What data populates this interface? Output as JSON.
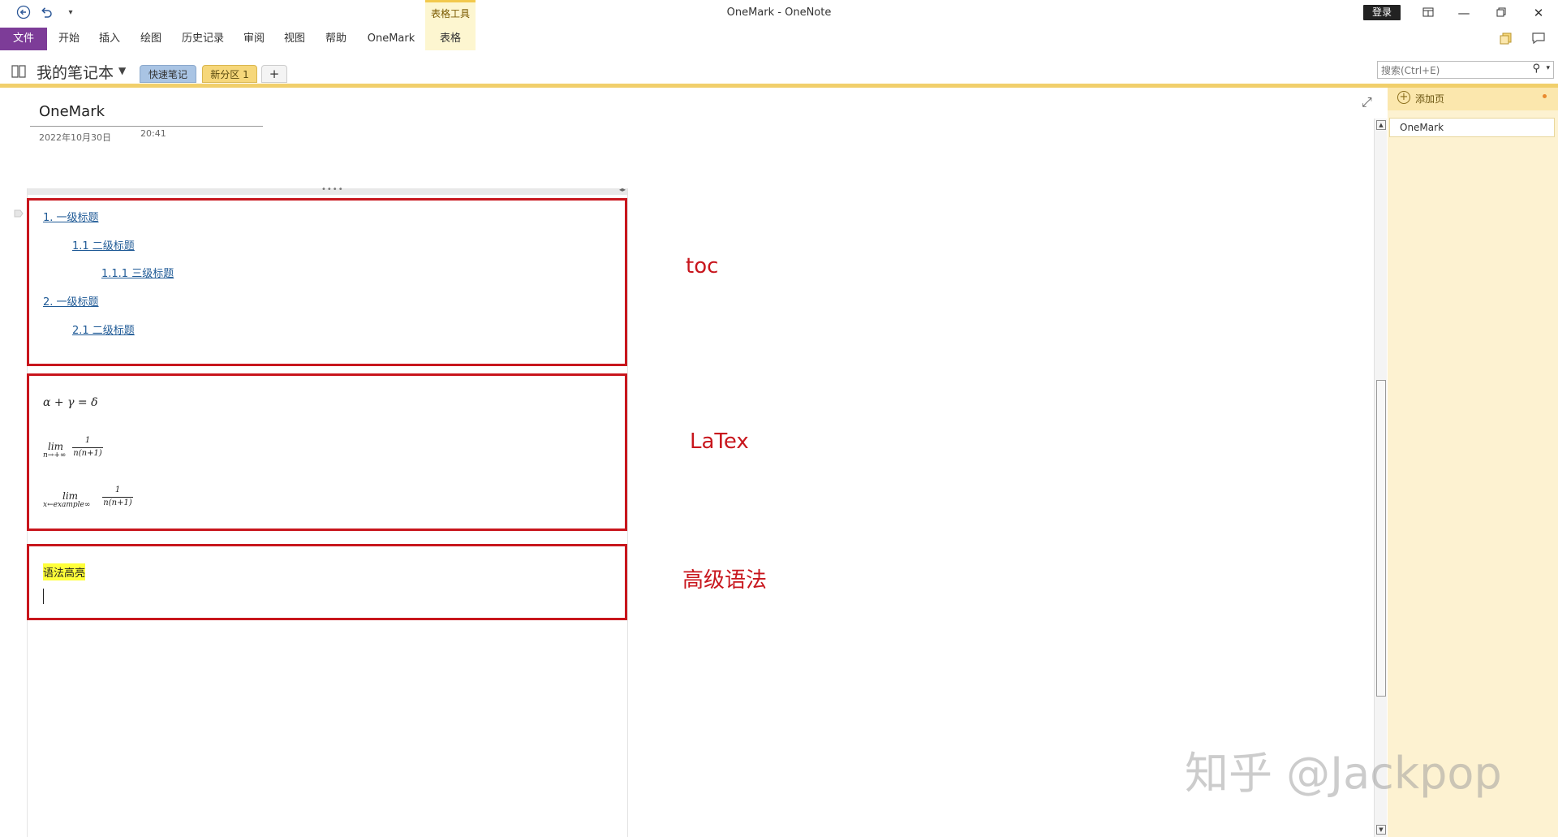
{
  "window": {
    "title": "OneMark  -  OneNote",
    "login_label": "登录",
    "ctx_group_title": "表格工具"
  },
  "ribbon": {
    "file_label": "文件",
    "tabs": [
      "开始",
      "插入",
      "绘图",
      "历史记录",
      "审阅",
      "视图",
      "帮助",
      "OneMark",
      "表格"
    ]
  },
  "notebook": {
    "title": "我的笔记本",
    "sections": [
      "快速笔记",
      "新分区 1"
    ],
    "add_section": "+"
  },
  "search": {
    "placeholder": "搜索(Ctrl+E)"
  },
  "page": {
    "title": "OneMark",
    "date": "2022年10月30日",
    "time": "20:41"
  },
  "toc": {
    "items": [
      "1. 一级标题",
      "1.1 二级标题",
      "1.1.1 三级标题",
      "2. 一级标题",
      "2.1 二级标题"
    ]
  },
  "latex": {
    "eq1": "α + γ = δ",
    "lim": "lim",
    "sub1": "n→+∞",
    "num": "1",
    "den": "n(n+1)",
    "sub2": "x←example∞"
  },
  "advanced": {
    "highlight_text": "语法高亮"
  },
  "annotations": {
    "toc": "toc",
    "latex": "LaTex",
    "advanced": "高级语法"
  },
  "pagepane": {
    "add_page": "添加页",
    "pages": [
      "OneMark"
    ]
  },
  "watermark": "知乎 @Jackpop",
  "colors": {
    "file_tab": "#7d3c98",
    "section_yellow": "#f1cf6b",
    "annotation_red": "#c8161d",
    "link_blue": "#1f5a96",
    "highlight": "#ffff3a"
  }
}
